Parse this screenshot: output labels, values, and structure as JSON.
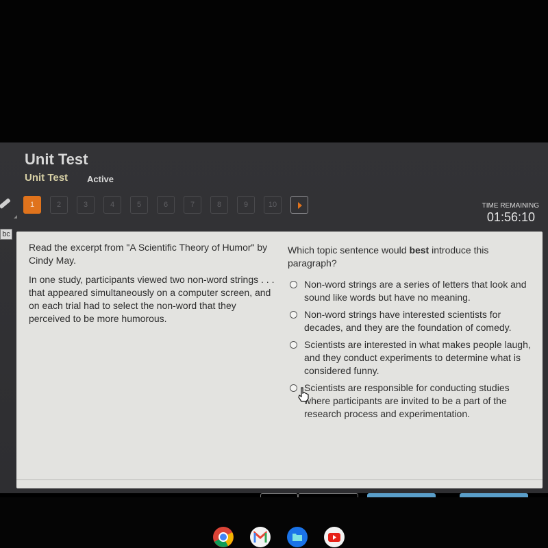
{
  "header": {
    "title": "Unit Test",
    "breadcrumb": "Unit Test",
    "status": "Active"
  },
  "question_nav": {
    "items": [
      "1",
      "2",
      "3",
      "4",
      "5",
      "6",
      "7",
      "8",
      "9",
      "10"
    ],
    "current": "1",
    "next_icon": "play-arrow-icon"
  },
  "timer": {
    "label": "TIME REMAINING",
    "value": "01:56:10"
  },
  "tools": {
    "pencil_icon": "pencil-icon",
    "abc_label": "bc"
  },
  "passage": {
    "intro": "Read the excerpt from \"A Scientific Theory of Humor\" by Cindy May.",
    "body": "In one study, participants viewed two non-word strings . . . that appeared simultaneously on a computer screen, and on each trial had to select the non-word that they perceived to be more humorous."
  },
  "question": {
    "prefix": "Which topic sentence would ",
    "emphasis": "best",
    "suffix": " introduce this paragraph?",
    "options": [
      "Non-word strings are a series of letters that look and sound like words but have no meaning.",
      "Non-word strings have interested scientists for decades, and they are the foundation of comedy.",
      "Scientists are interested in what makes people laugh, and they conduct experiments to determine what is considered funny.",
      "Scientists are responsible for conducting studies where participants are invited to be a part of the research process and experimentation."
    ]
  },
  "colors": {
    "accent": "#e0731c",
    "breadcrumb": "#d6cfa5",
    "panel": "#e3e3e0",
    "app_bg": "#333336"
  },
  "dock": [
    "chrome-icon",
    "gmail-icon",
    "files-icon",
    "youtube-icon"
  ]
}
